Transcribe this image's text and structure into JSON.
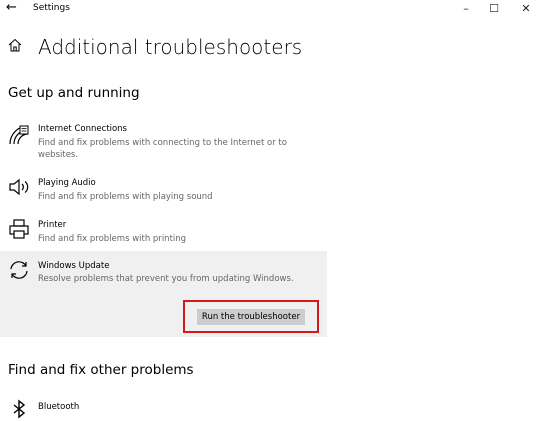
{
  "window": {
    "title": "Settings",
    "minimize_glyph": "–",
    "maximize_glyph": "☐",
    "close_glyph": "✕"
  },
  "page": {
    "title": "Additional troubleshooters"
  },
  "sections": {
    "get_up_running": {
      "heading": "Get up and running",
      "items": [
        {
          "title": "Internet Connections",
          "description": "Find and fix problems with connecting to the Internet or to websites.",
          "icon": "wifi-icon"
        },
        {
          "title": "Playing Audio",
          "description": "Find and fix problems with playing sound",
          "icon": "speaker-icon"
        },
        {
          "title": "Printer",
          "description": "Find and fix problems with printing",
          "icon": "printer-icon"
        },
        {
          "title": "Windows Update",
          "description": "Resolve problems that prevent you from updating Windows.",
          "icon": "refresh-icon"
        }
      ],
      "run_button_label": "Run the troubleshooter"
    },
    "other_problems": {
      "heading": "Find and fix other problems",
      "items": [
        {
          "title": "Bluetooth",
          "icon": "bluetooth-icon"
        }
      ]
    }
  },
  "colors": {
    "highlight_border": "#d21a1a",
    "selected_background": "#f0f0f0",
    "button_background": "#cccccc"
  }
}
